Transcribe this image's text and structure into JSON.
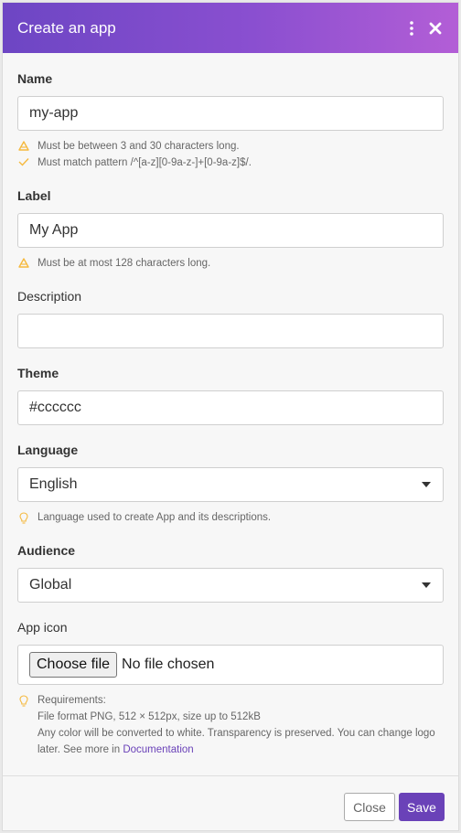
{
  "dialog": {
    "title": "Create an app",
    "menu_icon": "more-vertical-icon",
    "close_icon": "close-icon"
  },
  "colors": {
    "header_start": "#6d46c4",
    "header_end": "#b35ed6",
    "accent": "#6a42b8",
    "warning": "#f5b93e"
  },
  "form": {
    "name": {
      "label": "Name",
      "value": "my-app",
      "hints": [
        {
          "icon": "warning-icon",
          "text": "Must be between 3 and 30 characters long."
        },
        {
          "icon": "check-icon",
          "text": "Must match pattern /^[a-z][0-9a-z-]+[0-9a-z]$/."
        }
      ]
    },
    "label": {
      "label": "Label",
      "value": "My App",
      "hints": [
        {
          "icon": "warning-icon",
          "text": "Must be at most 128 characters long."
        }
      ]
    },
    "description": {
      "label": "Description",
      "value": ""
    },
    "theme": {
      "label": "Theme",
      "value": "#cccccc"
    },
    "language": {
      "label": "Language",
      "value": "English",
      "hint": {
        "icon": "lightbulb-icon",
        "text": "Language used to create App and its descriptions."
      }
    },
    "audience": {
      "label": "Audience",
      "value": "Global"
    },
    "app_icon": {
      "label": "App icon",
      "button": "Choose file",
      "status": "No file chosen",
      "requirements": {
        "icon": "lightbulb-icon",
        "line1": "Requirements:",
        "line2": "File format PNG, 512 × 512px, size up to 512kB",
        "line3": "Any color will be converted to white. Transparency is preserved. You can change logo later. See more in ",
        "link": "Documentation"
      }
    }
  },
  "footer": {
    "close_label": "Close",
    "save_label": "Save"
  }
}
